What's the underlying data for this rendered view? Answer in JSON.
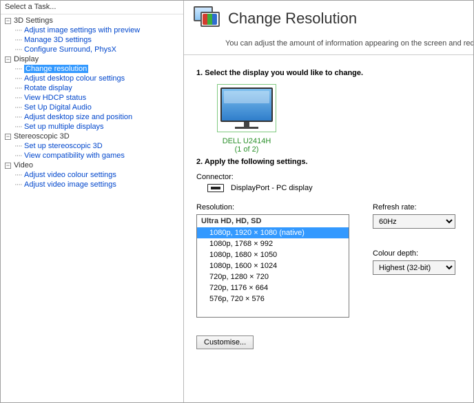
{
  "sidebar": {
    "header": "Select a Task...",
    "groups": [
      {
        "label": "3D Settings",
        "items": [
          "Adjust image settings with preview",
          "Manage 3D settings",
          "Configure Surround, PhysX"
        ]
      },
      {
        "label": "Display",
        "items": [
          "Change resolution",
          "Adjust desktop colour settings",
          "Rotate display",
          "View HDCP status",
          "Set Up Digital Audio",
          "Adjust desktop size and position",
          "Set up multiple displays"
        ],
        "selectedIndex": 0
      },
      {
        "label": "Stereoscopic 3D",
        "items": [
          "Set up stereoscopic 3D",
          "View compatibility with games"
        ]
      },
      {
        "label": "Video",
        "items": [
          "Adjust video colour settings",
          "Adjust video image settings"
        ]
      }
    ]
  },
  "main": {
    "title": "Change Resolution",
    "subtitle": "You can adjust the amount of information appearing on the screen and reduce",
    "step1": "1. Select the display you would like to change.",
    "displayName": "DELL U2414H",
    "displaySub": "(1 of 2)",
    "step2": "2. Apply the following settings.",
    "connectorLabel": "Connector:",
    "connectorValue": "DisplayPort - PC display",
    "resolutionLabel": "Resolution:",
    "resolutionHeader": "Ultra HD, HD, SD",
    "resolutionItems": [
      "1080p, 1920 × 1080 (native)",
      "1080p, 1768 × 992",
      "1080p, 1680 × 1050",
      "1080p, 1600 × 1024",
      "720p, 1280 × 720",
      "720p, 1176 × 664",
      "576p, 720 × 576"
    ],
    "resolutionSelectedIndex": 0,
    "refreshLabel": "Refresh rate:",
    "refreshValue": "60Hz",
    "depthLabel": "Colour depth:",
    "depthValue": "Highest (32-bit)",
    "customiseLabel": "Customise..."
  }
}
